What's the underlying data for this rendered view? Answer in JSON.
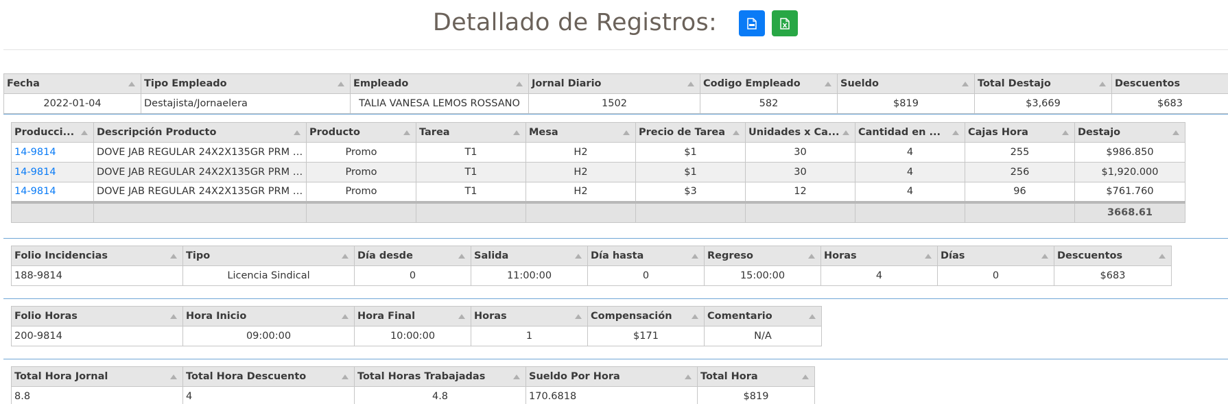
{
  "header": {
    "title": "Detallado de Registros:",
    "pdf_icon": "pdf-file-icon",
    "excel_icon": "excel-file-icon",
    "pdf_color": "#0a7bf6",
    "excel_color": "#28a745"
  },
  "main_table": {
    "columns": [
      "Fecha",
      "Tipo Empleado",
      "Empleado",
      "Jornal Diario",
      "Codigo Empleado",
      "Sueldo",
      "Total Destajo",
      "Descuentos"
    ],
    "row": [
      "2022-01-04",
      "Destajista/Jornaelera",
      "TALIA VANESA LEMOS ROSSANO",
      "1502",
      "582",
      "$819",
      "$3,669",
      "$683"
    ]
  },
  "production_table": {
    "columns": [
      "Producci...",
      "Descripción Producto",
      "Producto",
      "Tarea",
      "Mesa",
      "Precio de Tarea",
      "Unidades x Ca...",
      "Cantidad en ...",
      "Cajas Hora",
      "Destajo"
    ],
    "rows": [
      [
        "14-9814",
        "DOVE JAB REGULAR 24X2X135GR PRM 1...",
        "Promo",
        "T1",
        "H2",
        "$1",
        "30",
        "4",
        "255",
        "$986.850"
      ],
      [
        "14-9814",
        "DOVE JAB REGULAR 24X2X135GR PRM 1...",
        "Promo",
        "T1",
        "H2",
        "$1",
        "30",
        "4",
        "256",
        "$1,920.000"
      ],
      [
        "14-9814",
        "DOVE JAB REGULAR 24X2X135GR PRM 1...",
        "Promo",
        "T1",
        "H2",
        "$3",
        "12",
        "4",
        "96",
        "$761.760"
      ]
    ],
    "total": "3668.61"
  },
  "incidents_table": {
    "columns": [
      "Folio Incidencias",
      "Tipo",
      "Día desde",
      "Salida",
      "Día hasta",
      "Regreso",
      "Horas",
      "Días",
      "Descuentos"
    ],
    "row": [
      "188-9814",
      "Licencia Sindical",
      "0",
      "11:00:00",
      "0",
      "15:00:00",
      "4",
      "0",
      "$683"
    ]
  },
  "hours_table": {
    "columns": [
      "Folio Horas",
      "Hora Inicio",
      "Hora Final",
      "Horas",
      "Compensación",
      "Comentario"
    ],
    "row": [
      "200-9814",
      "09:00:00",
      "10:00:00",
      "1",
      "$171",
      "N/A"
    ]
  },
  "totals_table": {
    "columns": [
      "Total Hora Jornal",
      "Total Hora Descuento",
      "Total Horas Trabajadas",
      "Sueldo Por Hora",
      "Total Hora"
    ],
    "row": [
      "8.8",
      "4",
      "4.8",
      "170.6818",
      "$819"
    ]
  }
}
